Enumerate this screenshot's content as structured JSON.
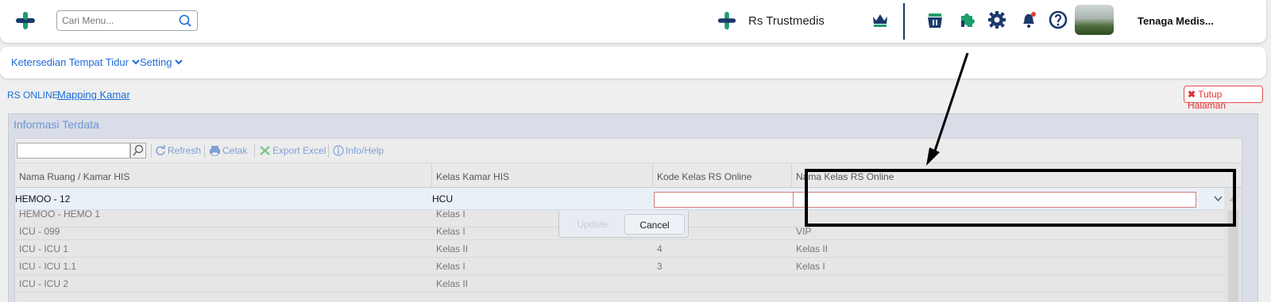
{
  "header": {
    "search_placeholder": "Cari Menu...",
    "hospital_name": "Rs Trustmedis",
    "user_name": "Tenaga Medis...",
    "icons": [
      "logo-icon",
      "search-icon",
      "crown-icon",
      "basket-icon",
      "puzzle-icon",
      "gear-icon",
      "bell-icon",
      "help-icon"
    ],
    "brand_color": "#1d9e6a",
    "icon_color": "#1a3a6b",
    "notification_color": "#e53935"
  },
  "menu": {
    "items": [
      {
        "label": "Ketersedian Tempat Tidur"
      },
      {
        "label": "Setting"
      }
    ]
  },
  "breadcrumb": {
    "parent": "RS ONLINE",
    "current": "Mapping Kamar"
  },
  "close_button": {
    "label": "Tutup Halaman"
  },
  "panel": {
    "title": "Informasi Terdata",
    "toolbar": {
      "refresh": "Refresh",
      "print": "Cetak",
      "export": "Export Excel",
      "info": "Info/Help"
    },
    "columns": [
      "Nama Ruang / Kamar HIS",
      "Kelas Kamar HIS",
      "Kode Kelas RS Online",
      "Nama Kelas RS Online"
    ],
    "edit_row": {
      "nama_ruang": "HEMOO - 12",
      "kelas_kamar": "HCU",
      "kode_kelas": "",
      "nama_kelas": ""
    },
    "rows": [
      {
        "nama_ruang": "HEMOO - HEMO 1",
        "kelas_kamar": "Kelas I",
        "kode_kelas": "",
        "nama_kelas": ""
      },
      {
        "nama_ruang": "ICU - 099",
        "kelas_kamar": "Kelas I",
        "kode_kelas": "",
        "nama_kelas": "VIP"
      },
      {
        "nama_ruang": "ICU - ICU 1",
        "kelas_kamar": "Kelas II",
        "kode_kelas": "4",
        "nama_kelas": "Kelas II"
      },
      {
        "nama_ruang": "ICU - ICU 1.1",
        "kelas_kamar": "Kelas I",
        "kode_kelas": "3",
        "nama_kelas": "Kelas I"
      },
      {
        "nama_ruang": "ICU - ICU 2",
        "kelas_kamar": "Kelas II",
        "kode_kelas": "",
        "nama_kelas": ""
      }
    ],
    "editor_buttons": {
      "update": "Update",
      "cancel": "Cancel"
    }
  },
  "colors": {
    "link": "#1d6bd6",
    "danger": "#e03030",
    "panel_title": "#6b95d3"
  }
}
